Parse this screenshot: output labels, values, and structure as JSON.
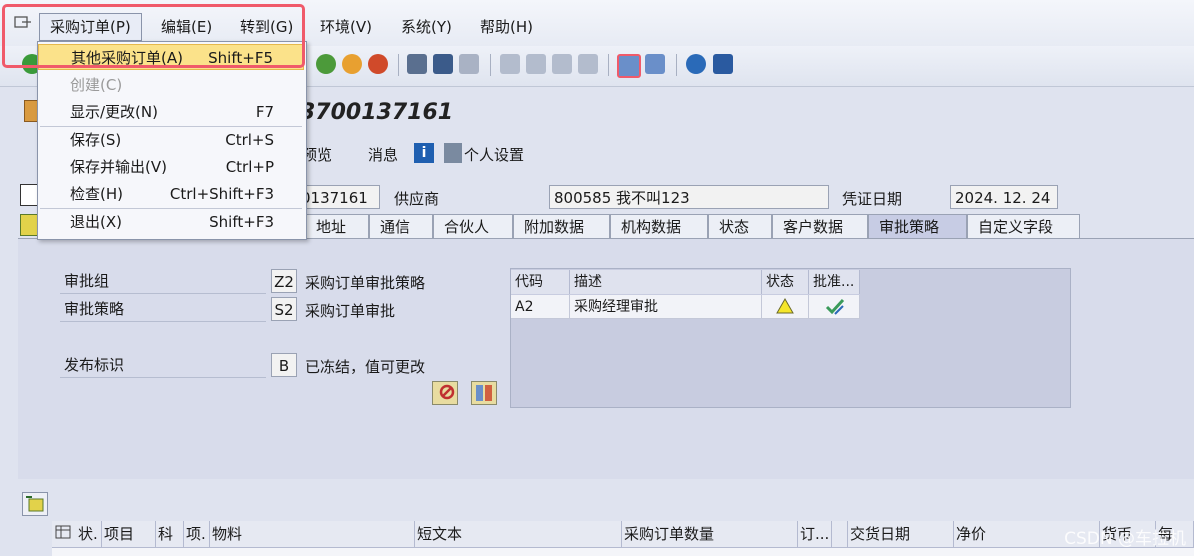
{
  "menubar": {
    "items": [
      "采购订单(P)",
      "编辑(E)",
      "转到(G)",
      "环境(V)",
      "系统(Y)",
      "帮助(H)"
    ]
  },
  "dropdown": {
    "items": [
      {
        "label": "其他采购订单(A)",
        "shortcut": "Shift+F5",
        "state": "highlighted"
      },
      {
        "label": "创建(C)",
        "shortcut": "",
        "state": "disabled"
      },
      {
        "label": "显示/更改(N)",
        "shortcut": "F7",
        "state": "normal"
      },
      {
        "label": "保存(S)",
        "shortcut": "Ctrl+S",
        "state": "normal"
      },
      {
        "label": "保存并输出(V)",
        "shortcut": "Ctrl+P",
        "state": "normal"
      },
      {
        "label": "检查(H)",
        "shortcut": "Ctrl+Shift+F3",
        "state": "normal"
      },
      {
        "label": "退出(X)",
        "shortcut": "Shift+F3",
        "state": "normal"
      }
    ]
  },
  "title": {
    "doc_number": "3700137161"
  },
  "app_toolbar": {
    "preview": "预览",
    "messages": "消息",
    "personal_settings": "个人设置"
  },
  "header": {
    "po_number_partial": "0137161",
    "vendor_label": "供应商",
    "vendor_value": "800585 我不叫123",
    "doc_date_label": "凭证日期",
    "doc_date_value": "2024. 12. 24"
  },
  "tabs": {
    "items": [
      "地址",
      "通信",
      "合伙人",
      "附加数据",
      "机构数据",
      "状态",
      "客户数据",
      "审批策略",
      "自定义字段"
    ],
    "active": "审批策略"
  },
  "approval": {
    "group_label": "审批组",
    "group_code": "Z2",
    "group_desc": "采购订单审批策略",
    "strategy_label": "审批策略",
    "strategy_code": "S2",
    "strategy_desc": "采购订单审批",
    "release_label": "发布标识",
    "release_code": "B",
    "release_desc": "已冻结，值可更改",
    "table": {
      "headers": [
        "代码",
        "描述",
        "状态",
        "批准..."
      ],
      "rows": [
        {
          "code": "A2",
          "desc": "采购经理审批",
          "status_icon": "warning-triangle-icon",
          "approve_icon": "approve-check-icon"
        }
      ]
    }
  },
  "items_grid": {
    "headers": [
      "状.",
      "项目",
      "科",
      "项.",
      "物料",
      "短文本",
      "采购订单数量",
      "订...",
      "",
      "交货日期",
      "净价",
      "货币",
      "每"
    ]
  },
  "watermark": "CSDN @车拉机",
  "colors": {
    "highlight_border": "#f05a6a",
    "menu_highlight": "#fbe28a",
    "background": "#dfe3ef"
  }
}
